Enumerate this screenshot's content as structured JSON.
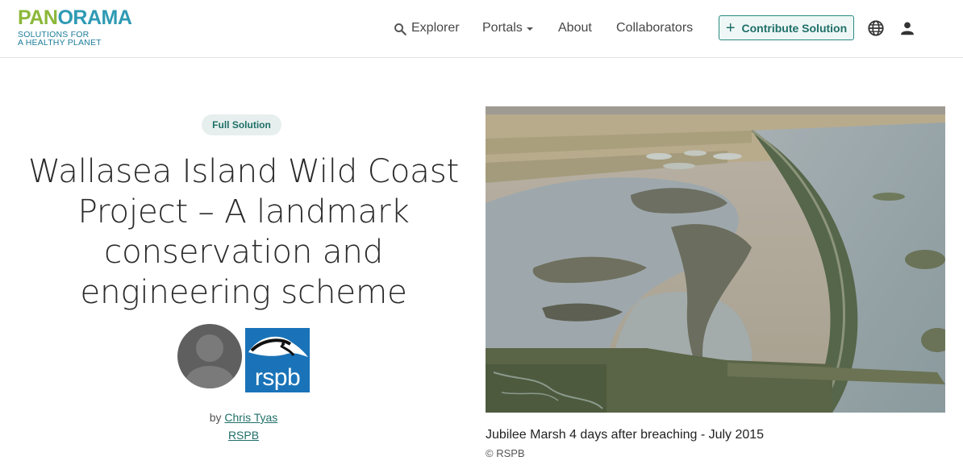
{
  "header": {
    "logo": {
      "word_part1": "PAN",
      "word_part2": "ORAMA",
      "sub_line1": "SOLUTIONS FOR",
      "sub_line2": "A HEALTHY PLANET"
    },
    "nav": {
      "explorer": "Explorer",
      "portals": "Portals",
      "about": "About",
      "collaborators": "Collaborators"
    },
    "contribute_label": "Contribute Solution",
    "icons": {
      "search": "search-icon",
      "globe": "globe-icon",
      "user": "user-icon",
      "plus": "plus-icon"
    }
  },
  "solution": {
    "badge": "Full Solution",
    "title": "Wallasea Island Wild Coast Project – A landmark conservation and engineering scheme",
    "by_prefix": "by",
    "author": "Chris Tyas",
    "organization": "RSPB",
    "org_logo_text": "rspb"
  },
  "image": {
    "caption": "Jubilee Marsh 4 days after breaching - July 2015",
    "credit": "© RSPB"
  },
  "colors": {
    "accent": "#1f6f68",
    "logo_green": "#8cb83a",
    "logo_blue": "#2f9ab4",
    "rspb_blue": "#1a73b8"
  }
}
